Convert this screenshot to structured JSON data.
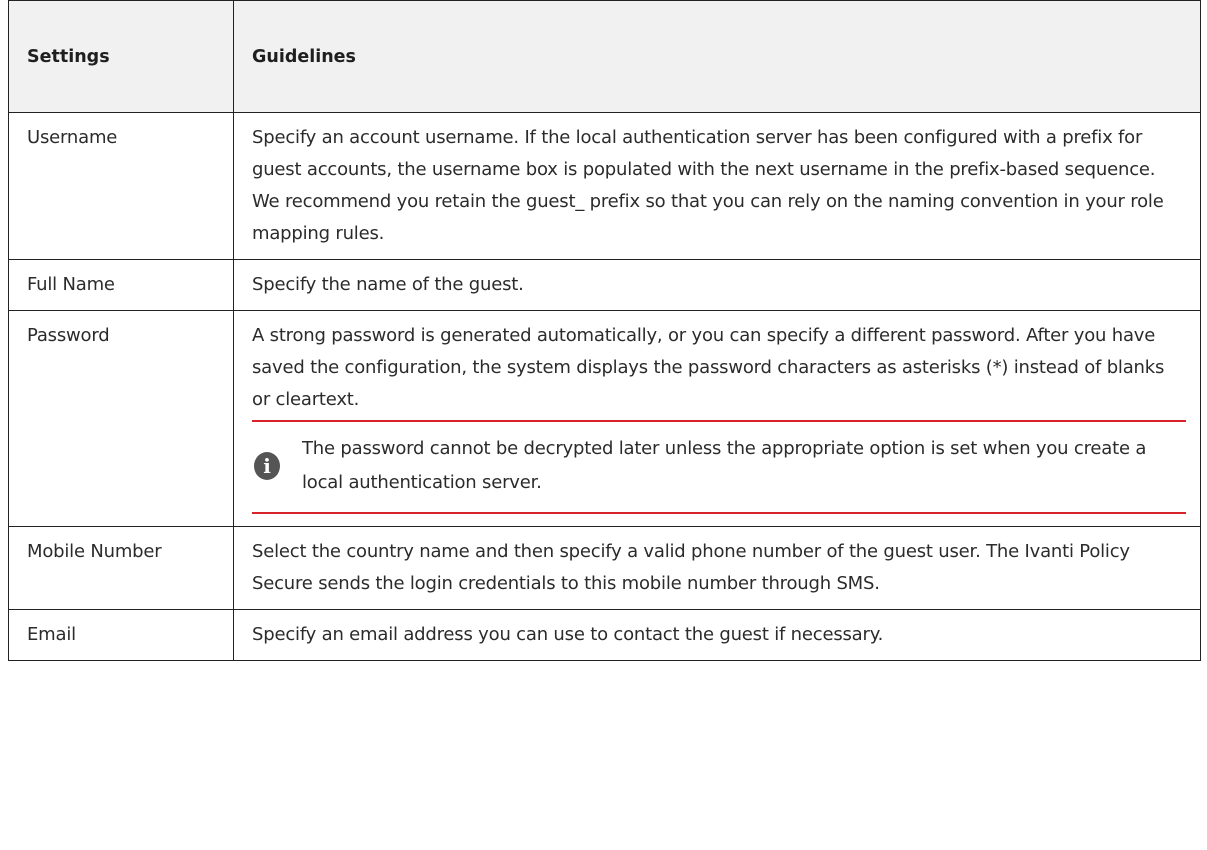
{
  "table": {
    "headers": {
      "settings": "Settings",
      "guidelines": "Guidelines"
    },
    "rows": [
      {
        "setting": "Username",
        "guideline": "Specify an account username. If the local authentication server has been configured with a prefix for guest accounts, the username box is populated with the next username in the prefix-based sequence. We recommend you retain the guest_ prefix so that you can rely on the naming convention in your role mapping rules."
      },
      {
        "setting": "Full Name",
        "guideline": "Specify the name of the guest."
      },
      {
        "setting": "Password",
        "guideline": "A strong password is generated automatically, or you can specify a different password. After you have saved the configuration, the system displays the password characters as asterisks (*) instead of blanks or cleartext.",
        "note": {
          "icon": "info-icon",
          "icon_glyph": "i",
          "text": "The password cannot be decrypted later unless the appropriate option is set when you create a local authentication server."
        }
      },
      {
        "setting": "Mobile Number",
        "guideline": "Select the country name and then specify a valid phone number of the guest user. The Ivanti Policy Secure sends the login credentials to this mobile number through SMS."
      },
      {
        "setting": "Email",
        "guideline": "Specify an email address you can use to contact the guest if necessary."
      }
    ]
  },
  "colors": {
    "header_bg": "#f1f1f1",
    "border": "#222222",
    "note_rule": "#d9232a",
    "note_icon_bg": "#555555",
    "text": "#2b2b2b"
  }
}
